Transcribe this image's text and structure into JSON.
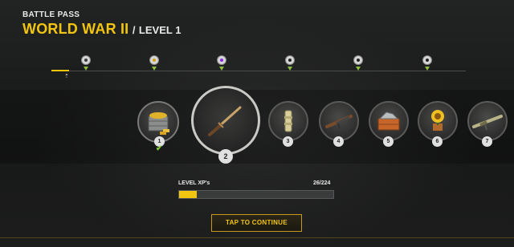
{
  "header": {
    "pass_label": "BATTLE PASS",
    "title": "WORLD WAR II",
    "separator": "/",
    "level": "LEVEL 1"
  },
  "track": {
    "marker": "⇡",
    "nodes": [
      {
        "icon": "crate-icon",
        "color": "#3a3a3a"
      },
      {
        "icon": "coin-icon",
        "color": "#d4a010"
      },
      {
        "icon": "mask-icon",
        "color": "#8a2be2"
      },
      {
        "icon": "wings-icon",
        "color": "#222222"
      },
      {
        "icon": "skull-icon",
        "color": "#222222"
      },
      {
        "icon": "trophy-icon",
        "color": "#222222"
      }
    ]
  },
  "rewards": [
    {
      "number": "1",
      "icon": "gold-crate-icon",
      "claimed": true
    },
    {
      "number": "2",
      "icon": "bayonet-icon",
      "selected": true
    },
    {
      "number": "3",
      "icon": "canister-icon"
    },
    {
      "number": "4",
      "icon": "smg-rifle-icon"
    },
    {
      "number": "5",
      "icon": "supply-crate-icon"
    },
    {
      "number": "6",
      "icon": "sunflower-badge-icon"
    },
    {
      "number": "7",
      "icon": "camo-rifle-icon"
    }
  ],
  "xp": {
    "label": "LEVEL XP's",
    "value": "26/224",
    "progress": 0.116,
    "fill_color": "#f2c511"
  },
  "continue_button": {
    "label": "TAP TO CONTINUE"
  },
  "colors": {
    "accent": "#f2c511",
    "background": "#1b1c1c",
    "claimed": "#7fcf37"
  }
}
